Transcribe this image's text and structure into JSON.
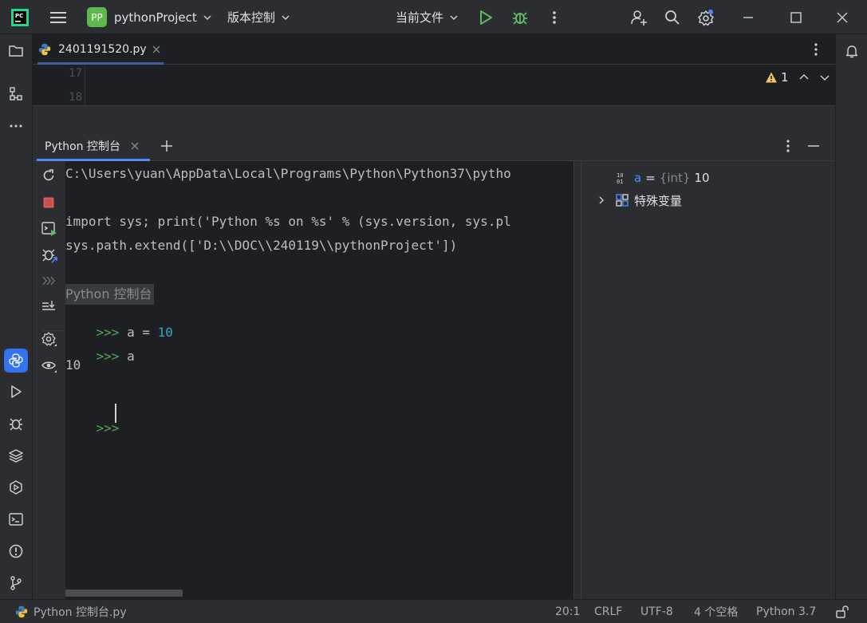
{
  "titlebar": {
    "app_icon": "pycharm-logo",
    "project_badge": "PP",
    "project_name": "pythonProject",
    "vcs_label": "版本控制",
    "run_config": "当前文件",
    "badge_color": "#5fb84c"
  },
  "editor": {
    "tab_label": "2401191520.py",
    "line_numbers": [
      "17",
      "18"
    ],
    "warning_count": "1"
  },
  "console": {
    "tab_label": "Python 控制台",
    "lines": [
      {
        "kind": "plain",
        "text": "C:\\Users\\yuan\\AppData\\Local\\Programs\\Python\\Python37\\pytho"
      },
      {
        "kind": "plain",
        "text": "import sys; print('Python %s on %s' % (sys.version, sys.pl"
      },
      {
        "kind": "plain",
        "text": "sys.path.extend(['D:\\\\DOC\\\\240119\\\\pythonProject'])"
      },
      {
        "kind": "banner",
        "text": "Python 控制台"
      },
      {
        "kind": "assign",
        "prompt": ">>>",
        "code": "a = ",
        "value": "10"
      },
      {
        "kind": "input",
        "prompt": ">>>",
        "code": "a"
      },
      {
        "kind": "plain",
        "text": "10"
      },
      {
        "kind": "empty_prompt",
        "prompt": ">>>"
      }
    ]
  },
  "variables": {
    "items": [
      {
        "name": "a",
        "type": "{int}",
        "value": "10"
      }
    ],
    "special_label": "特殊变量"
  },
  "statusbar": {
    "left_label": "Python 控制台.py",
    "position": "20:1",
    "line_ending": "CRLF",
    "encoding": "UTF-8",
    "indent": "4 个空格",
    "interpreter": "Python 3.7"
  }
}
